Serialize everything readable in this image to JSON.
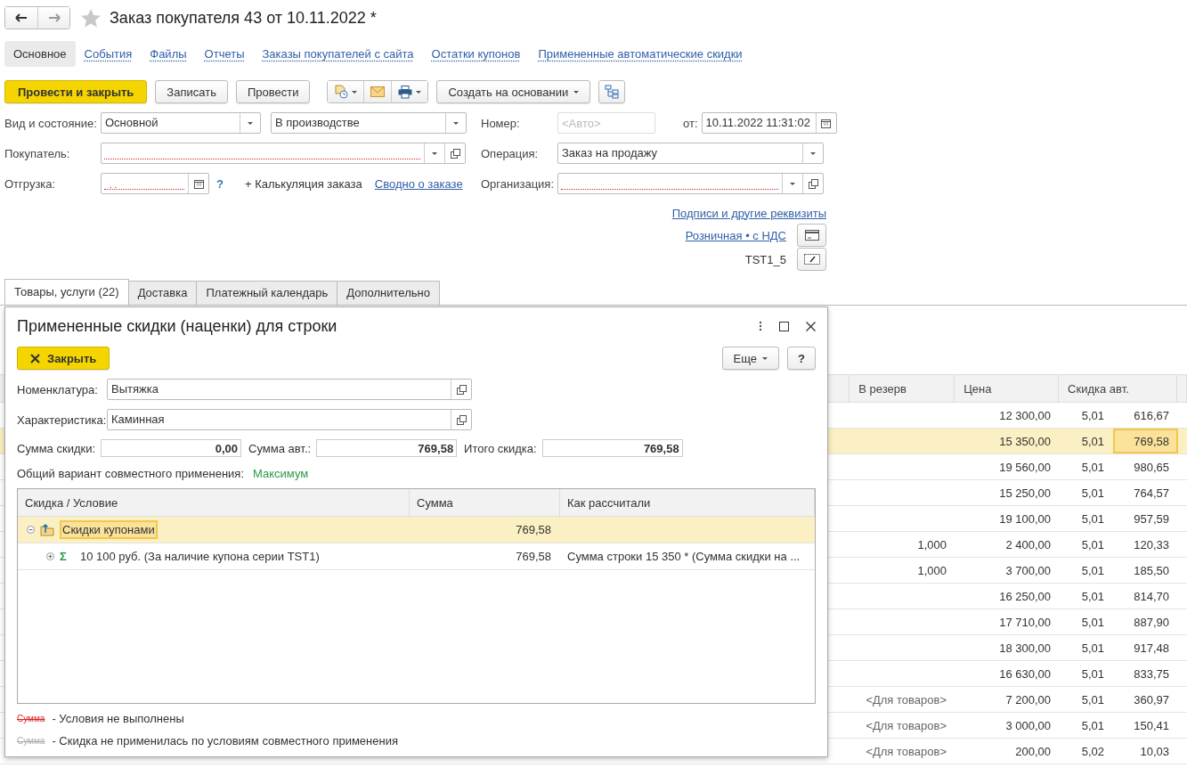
{
  "header": {
    "title": "Заказ покупателя 43 от 10.11.2022 *"
  },
  "sections": [
    {
      "label": "Основное",
      "selected": true
    },
    {
      "label": "События",
      "selected": false
    },
    {
      "label": "Файлы",
      "selected": false
    },
    {
      "label": "Отчеты",
      "selected": false
    },
    {
      "label": "Заказы покупателей с сайта",
      "selected": false
    },
    {
      "label": "Остатки купонов",
      "selected": false
    },
    {
      "label": "Примененные автоматические скидки",
      "selected": false
    }
  ],
  "toolbar": {
    "post_close": "Провести и закрыть",
    "save": "Записать",
    "post": "Провести",
    "create_based": "Создать на основании"
  },
  "form": {
    "kind_label": "Вид и состояние:",
    "kind": "Основной",
    "state": "В производстве",
    "number_label": "Номер:",
    "number_placeholder": "<Авто>",
    "date_label": "от:",
    "date": "10.11.2022 11:31:02",
    "buyer_label": "Покупатель:",
    "buyer_required": true,
    "operation_label": "Операция:",
    "operation": "Заказ на продажу",
    "shipment_label": "Отгрузка:",
    "shipment_mask": ".  .",
    "shipment_required": true,
    "help": "?",
    "calc": "+ Калькуляция заказа",
    "summary_link": "Сводно о заказе",
    "org_label": "Организация:",
    "org_required": true,
    "signatures_link": "Подписи и другие реквизиты",
    "price_link": "Розничная • с НДС",
    "coupon": "TST1_5"
  },
  "tabs": [
    {
      "label": "Товары, услуги (22)",
      "selected": true
    },
    {
      "label": "Доставка",
      "selected": false
    },
    {
      "label": "Платежный календарь",
      "selected": false
    },
    {
      "label": "Дополнительно",
      "selected": false
    }
  ],
  "table": {
    "columns": [
      "В резерв",
      "Цена",
      "Скидка авт."
    ],
    "rows": [
      {
        "price": "12 300,00",
        "pct": "5,01",
        "sum": "616,67",
        "selected": false
      },
      {
        "price": "15 350,00",
        "pct": "5,01",
        "sum": "769,58",
        "selected": true
      },
      {
        "price": "19 560,00",
        "pct": "5,01",
        "sum": "980,65",
        "selected": false
      },
      {
        "price": "15 250,00",
        "pct": "5,01",
        "sum": "764,57",
        "selected": false
      },
      {
        "price": "19 100,00",
        "pct": "5,01",
        "sum": "957,59",
        "selected": false
      },
      {
        "reserve": "1,000",
        "price": "2 400,00",
        "pct": "5,01",
        "sum": "120,33",
        "selected": false
      },
      {
        "reserve": "1,000",
        "price": "3 700,00",
        "pct": "5,01",
        "sum": "185,50",
        "selected": false
      },
      {
        "price": "16 250,00",
        "pct": "5,01",
        "sum": "814,70",
        "selected": false
      },
      {
        "price": "17 710,00",
        "pct": "5,01",
        "sum": "887,90",
        "selected": false
      },
      {
        "price": "18 300,00",
        "pct": "5,01",
        "sum": "917,48",
        "selected": false
      },
      {
        "price": "16 630,00",
        "pct": "5,01",
        "sum": "833,75",
        "selected": false
      },
      {
        "reserve": "<Для товаров>",
        "price": "7 200,00",
        "pct": "5,01",
        "sum": "360,97",
        "selected": false
      },
      {
        "reserve": "<Для товаров>",
        "price": "3 000,00",
        "pct": "5,01",
        "sum": "150,41",
        "selected": false
      },
      {
        "reserve": "<Для товаров>",
        "price": "200,00",
        "pct": "5,02",
        "sum": "10,03",
        "selected": false
      }
    ]
  },
  "dialog": {
    "title": "Примененные скидки (наценки) для строки",
    "close_button": "Закрыть",
    "more_button": "Еще",
    "help_button": "?",
    "nomenclature_label": "Номенклатура:",
    "nomenclature": "Вытяжка",
    "characteristic_label": "Характеристика:",
    "characteristic": "Каминная",
    "discount_sum_label": "Сумма скидки:",
    "discount_sum": "0,00",
    "auto_sum_label": "Сумма авт.:",
    "auto_sum": "769,58",
    "total_label": "Итого скидка:",
    "total": "769,58",
    "variant_label": "Общий вариант совместного применения:",
    "variant": "Максимум",
    "tree": {
      "columns": [
        "Скидка / Условие",
        "Сумма",
        "Как рассчитали"
      ],
      "rows": [
        {
          "kind": "group",
          "name": "Скидки купонами",
          "sum": "769,58",
          "expanded": true,
          "selected": true,
          "children": [
            {
              "kind": "condition",
              "icon": "Σ",
              "name": "10 100 руб. (За наличие купона серии TST1)",
              "sum": "769,58",
              "how": "Сумма строки 15 350 * (Сумма скидки на ...",
              "expanded": false,
              "selected": false
            }
          ]
        }
      ]
    },
    "legend": [
      {
        "kind": "failed",
        "sample": "Сумма",
        "text": "- Условия не выполнены"
      },
      {
        "kind": "skipped",
        "sample": "Сумма",
        "text": "- Скидка не применилась по условиям совместного применения"
      }
    ]
  }
}
